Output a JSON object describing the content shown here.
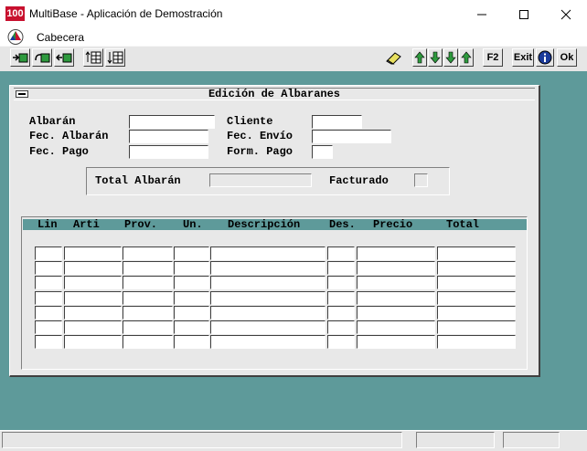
{
  "window": {
    "icon_text": "100",
    "title": "MultiBase - Aplicación de Demostración"
  },
  "menu": {
    "items": [
      {
        "label": "Cabecera"
      }
    ]
  },
  "toolbar": {
    "f2_label": "F2",
    "exit_label": "Exit",
    "ok_label": "Ok"
  },
  "form": {
    "title": "Edición de Albaranes",
    "labels": {
      "albaran": "Albarán",
      "fec_albaran": "Fec. Albarán",
      "fec_pago": "Fec. Pago",
      "cliente": "Cliente",
      "fec_envio": "Fec. Envío",
      "form_pago": "Form. Pago",
      "total_albaran": "Total Albarán",
      "facturado": "Facturado"
    },
    "values": {
      "albaran": "",
      "fec_albaran": "",
      "fec_pago": "",
      "cliente": "",
      "fec_envio": "",
      "form_pago": "",
      "total_albaran": "",
      "facturado": ""
    }
  },
  "lines_table": {
    "headers": [
      "Lin",
      "Arti",
      "Prov.",
      "Un.",
      "Descripción",
      "Des.",
      "Precio",
      "Total"
    ],
    "rows": [
      [
        "",
        "",
        "",
        "",
        "",
        "",
        "",
        ""
      ],
      [
        "",
        "",
        "",
        "",
        "",
        "",
        "",
        ""
      ],
      [
        "",
        "",
        "",
        "",
        "",
        "",
        "",
        ""
      ],
      [
        "",
        "",
        "",
        "",
        "",
        "",
        "",
        ""
      ],
      [
        "",
        "",
        "",
        "",
        "",
        "",
        "",
        ""
      ],
      [
        "",
        "",
        "",
        "",
        "",
        "",
        "",
        ""
      ],
      [
        "",
        "",
        "",
        "",
        "",
        "",
        "",
        ""
      ]
    ]
  },
  "colors": {
    "background": "#5e9a9a",
    "panel": "#e8e8e8",
    "app_icon": "#c8102e",
    "info_icon": "#1a3a9a",
    "nav_arrow": "#2e9a3e"
  }
}
